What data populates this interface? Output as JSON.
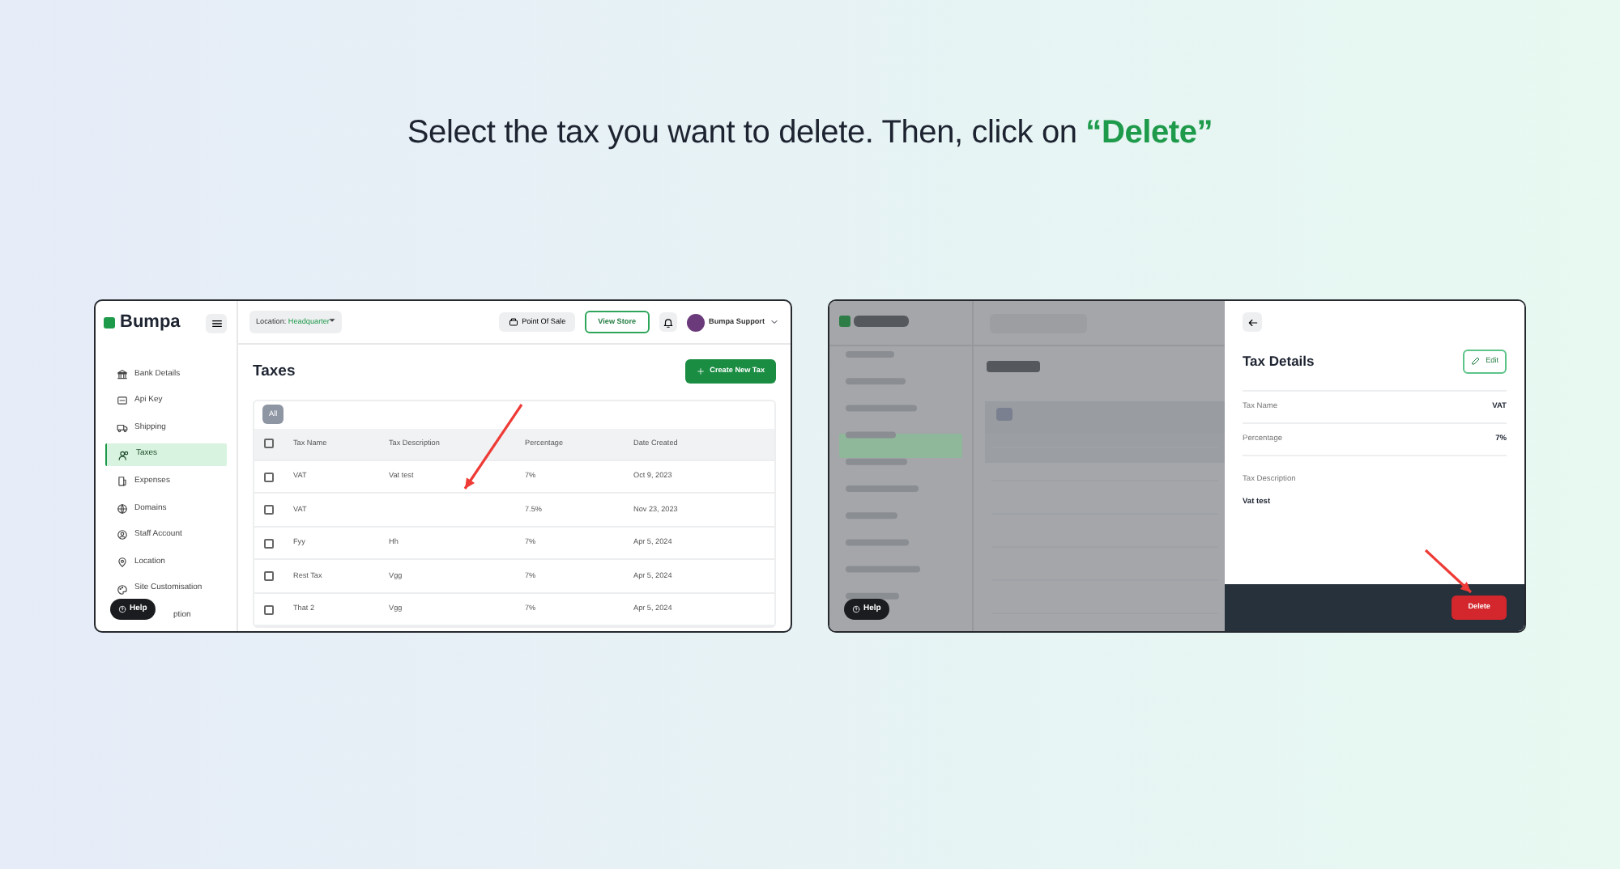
{
  "heading": {
    "text": "Select the tax you want to delete. Then, click on ",
    "highlight": "“Delete”"
  },
  "left_screen": {
    "logo": "Bumpa",
    "sidebar": {
      "items": [
        {
          "label": "Bank Details",
          "selected": false
        },
        {
          "label": "Api Key",
          "selected": false
        },
        {
          "label": "Shipping",
          "selected": false
        },
        {
          "label": "Taxes",
          "selected": true
        },
        {
          "label": "Expenses",
          "selected": false
        },
        {
          "label": "Domains",
          "selected": false
        },
        {
          "label": "Staff Account",
          "selected": false
        },
        {
          "label": "Location",
          "selected": false
        },
        {
          "label": "Site Customisation",
          "selected": false
        },
        {
          "label": "ption",
          "selected": false
        }
      ]
    },
    "topbar": {
      "location_label": "Location:",
      "location_value": "Headquarter",
      "pos_button": "Point Of Sale",
      "store_button": "View Store",
      "user": "Bumpa Support"
    },
    "page_title": "Taxes",
    "create_button": "Create New Tax",
    "filters": [
      {
        "label": "All",
        "selected": true
      }
    ],
    "table": {
      "select_all_checked": false,
      "columns": [
        "Tax Name",
        "Tax Description",
        "Percentage",
        "Date Created"
      ],
      "rows": [
        {
          "checked": false,
          "cells": [
            "VAT",
            "Vat test",
            "7%",
            "Oct 9, 2023"
          ]
        },
        {
          "checked": false,
          "cells": [
            "VAT",
            "",
            "7.5%",
            "Nov 23, 2023"
          ]
        },
        {
          "checked": false,
          "cells": [
            "Fyy",
            "Hh",
            "7%",
            "Apr 5, 2024"
          ]
        },
        {
          "checked": false,
          "cells": [
            "Rest Tax",
            "Vgg",
            "7%",
            "Apr 5, 2024"
          ]
        },
        {
          "checked": false,
          "cells": [
            "That 2",
            "Vgg",
            "7%",
            "Apr 5, 2024"
          ]
        }
      ]
    },
    "help_button": "Help"
  },
  "right_screen": {
    "help_button": "Help",
    "panel": {
      "title": "Tax Details",
      "edit_button": "Edit",
      "fields": [
        {
          "label": "Tax Name",
          "value": "VAT"
        },
        {
          "label": "Percentage",
          "value": "7%"
        }
      ],
      "description_label": "Tax Description",
      "description": "Vat test",
      "delete_button": "Delete"
    }
  }
}
